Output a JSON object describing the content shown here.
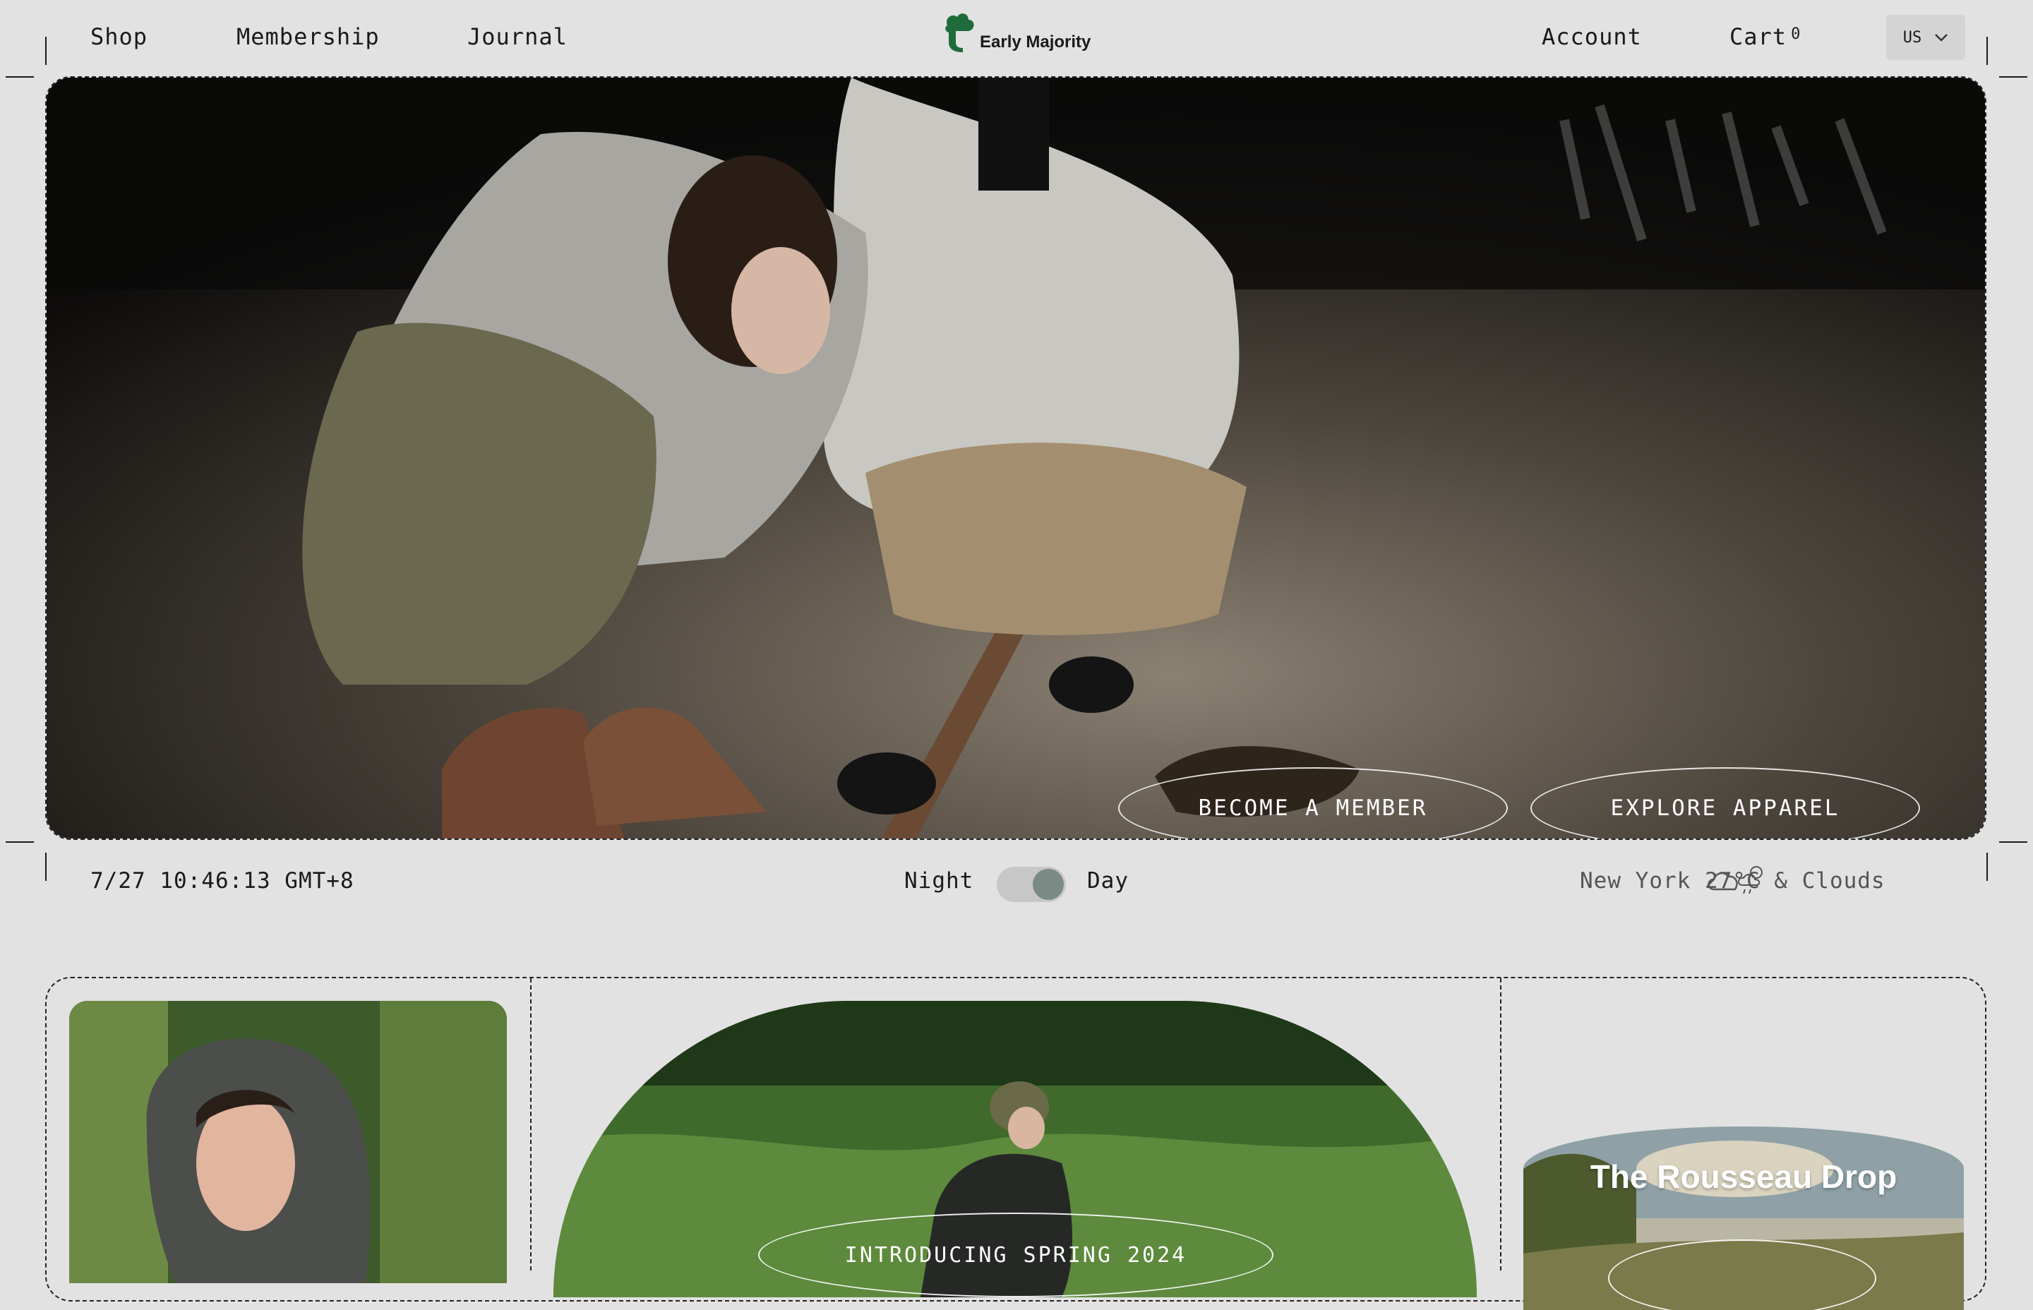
{
  "header": {
    "nav": [
      "Shop",
      "Membership",
      "Journal"
    ],
    "brand": "Early Majority",
    "account": "Account",
    "cart": "Cart",
    "cart_count": "0",
    "locale": "US"
  },
  "hero": {
    "primary_cta": "BECOME A MEMBER",
    "secondary_cta": "EXPLORE APPAREL"
  },
  "status_bar": {
    "datetime": "7/27 10:46:13 GMT+8",
    "night_label": "Night",
    "day_label": "Day",
    "weather": "New York  27°C & Clouds"
  },
  "cards": {
    "spring_label": "INTRODUCING SPRING 2024",
    "drop_title": "The Rousseau Drop"
  },
  "colors": {
    "accent": "#1f6b3a",
    "background": "#e2e2e2",
    "text": "#1a1a1a"
  }
}
